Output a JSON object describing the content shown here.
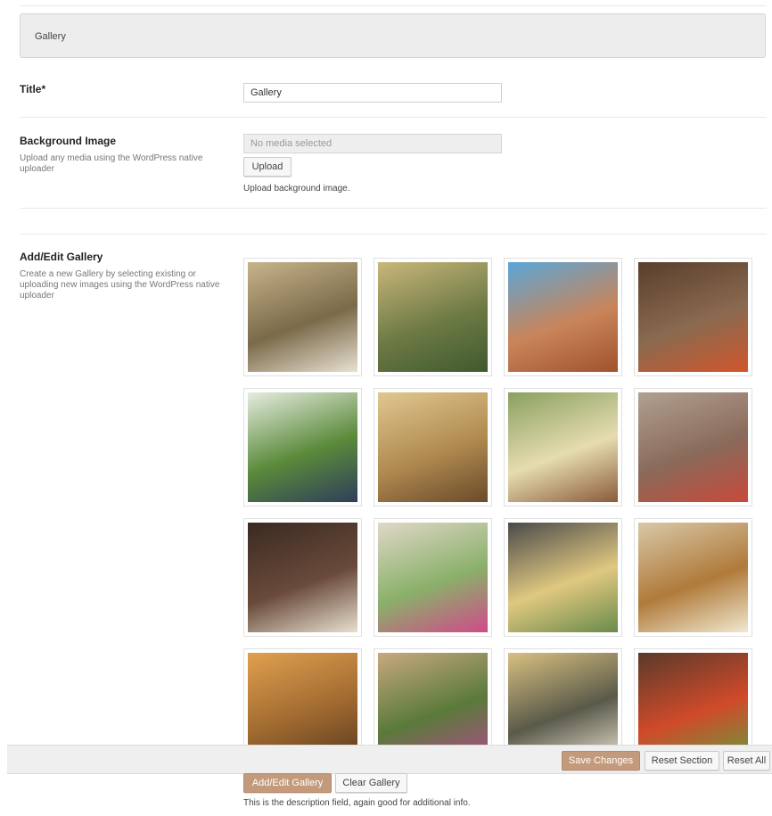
{
  "section": {
    "title": "Gallery"
  },
  "fields": {
    "title": {
      "label": "Title*",
      "value": "Gallery"
    },
    "background_image": {
      "label": "Background Image",
      "description": "Upload any media using the WordPress native uploader",
      "placeholder": "No media selected",
      "upload_label": "Upload",
      "help": "Upload background image."
    },
    "gallery": {
      "label": "Add/Edit Gallery",
      "description": "Create a new Gallery by selecting existing or uploading new images using the WordPress native uploader",
      "add_edit_label": "Add/Edit Gallery",
      "clear_label": "Clear Gallery",
      "help": "This is the description field, again good for additional info.",
      "images": [
        {
          "name": "gallery-image-outdoor-dining-table",
          "colors": [
            "#c8b48a",
            "#7a6a4a",
            "#e8e0d0"
          ]
        },
        {
          "name": "gallery-image-tuscan-hills",
          "colors": [
            "#c9b77a",
            "#6e7a45",
            "#3e5a2e"
          ]
        },
        {
          "name": "gallery-image-florence-duomo",
          "colors": [
            "#5aa6d8",
            "#c9855a",
            "#a0522d"
          ]
        },
        {
          "name": "gallery-image-spices-on-wood",
          "colors": [
            "#5a3e2b",
            "#8a6a50",
            "#d0562a"
          ]
        },
        {
          "name": "gallery-image-vineyard-grapes",
          "colors": [
            "#e6ece0",
            "#5a8a3a",
            "#2e3e5a"
          ]
        },
        {
          "name": "gallery-image-ponte-vecchio",
          "colors": [
            "#e0c890",
            "#b08a50",
            "#6a4a2a"
          ]
        },
        {
          "name": "gallery-image-cafe-terrace",
          "colors": [
            "#8aa060",
            "#e6dcb0",
            "#8a5a3a"
          ]
        },
        {
          "name": "gallery-image-flower-street",
          "colors": [
            "#b0a090",
            "#8a6a5a",
            "#c84a3a"
          ]
        },
        {
          "name": "gallery-image-bistecca-sign",
          "colors": [
            "#3a2a22",
            "#6a4a3a",
            "#e8e0d0"
          ]
        },
        {
          "name": "gallery-image-patio-plants",
          "colors": [
            "#e0d8c8",
            "#8ab06a",
            "#d04a8a"
          ]
        },
        {
          "name": "gallery-image-pasta-plate",
          "colors": [
            "#4a4a4a",
            "#e0c880",
            "#6a8a4a"
          ]
        },
        {
          "name": "gallery-image-hummus-bowls",
          "colors": [
            "#d8c8a8",
            "#b07a3a",
            "#f0e8d0"
          ]
        },
        {
          "name": "gallery-image-tuscan-sunset",
          "colors": [
            "#e0a050",
            "#a06a30",
            "#5a3a1e"
          ]
        },
        {
          "name": "gallery-image-ivy-alley",
          "colors": [
            "#c8a880",
            "#5a7a3a",
            "#b04a8a"
          ]
        },
        {
          "name": "gallery-image-wine-glasses-table",
          "colors": [
            "#d8c080",
            "#5a5a4a",
            "#e8e0d0"
          ]
        },
        {
          "name": "gallery-image-fresh-vegetables",
          "colors": [
            "#5a3a2a",
            "#d04a2a",
            "#6a9a3a"
          ]
        }
      ]
    }
  },
  "footer": {
    "save_label": "Save Changes",
    "reset_section_label": "Reset Section",
    "reset_all_label": "Reset All"
  }
}
